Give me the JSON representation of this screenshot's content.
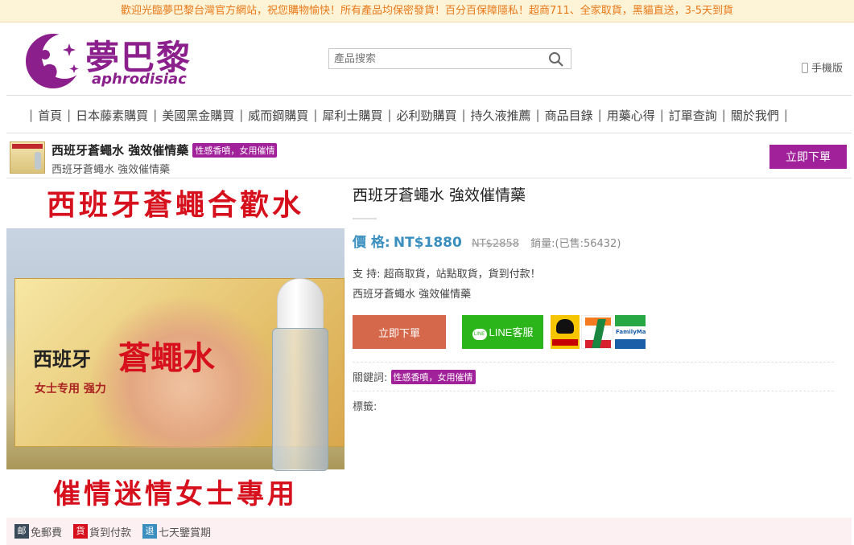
{
  "topbar": {
    "text": "歡迎光臨夢巴黎台灣官方網站，祝您購物愉快！所有產品均保密發貨！百分百保障隱私！超商711、全家取貨，黑貓直送，3-5天到貨"
  },
  "logo": {
    "title": "夢巴黎",
    "subtitle": "aphrodisiac",
    "icon": "moon-figure-logo"
  },
  "search": {
    "placeholder": "產品搜索",
    "icon": "search-icon"
  },
  "mobile": {
    "label": "手機版",
    "icon": "phone-icon"
  },
  "nav": {
    "items": [
      "首頁",
      "日本藤素購買",
      "美國黑金購買",
      "威而鋼購買",
      "犀利士購買",
      "必利勁購買",
      "持久液推薦",
      "商品目錄",
      "用藥心得",
      "訂單查詢",
      "關於我們"
    ]
  },
  "product_bar": {
    "title": "西班牙蒼蠅水 強效催情藥",
    "tag": "性感香噴，女用催情",
    "subtitle": "西班牙蒼蠅水 強效催情藥",
    "buy_label": "立即下單"
  },
  "hero": {
    "top_text": "西班牙蒼蠅合歡水",
    "box_title_black": "西班牙",
    "box_title_red": "蒼蠅水",
    "box_small": "女士专用 强力",
    "bottom_text": "催情迷情女士專用"
  },
  "product": {
    "title": "西班牙蒼蠅水 強效催情藥",
    "price_label": "價 格:",
    "price": "NT$1880",
    "old_price": "NT$2858",
    "sales": "銷量:(已售:56432)",
    "support": "支  持:   超商取貨，站點取貨，貨到付款！",
    "desc": "西班牙蒼蠅水 強效催情藥",
    "order_label": "立即下單",
    "line_label": "LINE客服",
    "keywords_label": "關鍵詞:",
    "keyword_tag": "性感香噴，女用催情",
    "tags_label": "標籤:",
    "shipping_logos": [
      "black-cat-logo",
      "seven-eleven-logo",
      "familymart-logo"
    ],
    "familymart_text": "FamilyMart"
  },
  "bottom": {
    "items": [
      {
        "icon_text": "邮",
        "label": "免郵費",
        "color": "#3b4a5a"
      },
      {
        "icon_text": "貨",
        "label": "貨到付款",
        "color": "#d6111d"
      },
      {
        "icon_text": "退",
        "label": "七天鑒賞期",
        "color": "#3a8fbf"
      }
    ]
  },
  "colors": {
    "accent": "#a0219a",
    "price": "#3a8fbf",
    "order": "#d5684b",
    "line": "#2bb51b",
    "topbar_text": "#e8791a"
  }
}
